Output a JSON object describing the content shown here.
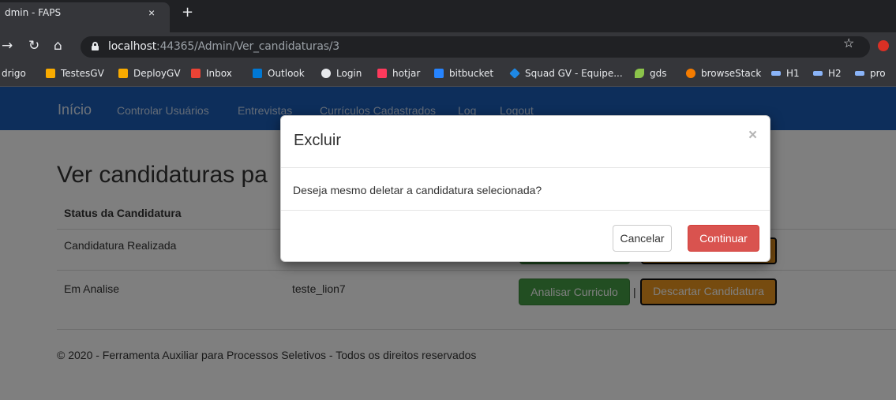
{
  "browser": {
    "tab_title": "dmin - FAPS",
    "tab_close": "×",
    "new_tab": "+",
    "url_host": "localhost",
    "url_rest": ":44365/Admin/Ver_candidaturas/3",
    "bookmarks": [
      {
        "label": "drigo",
        "color": "#000000"
      },
      {
        "label": "TestesGV",
        "color": "#f9ab00"
      },
      {
        "label": "DeployGV",
        "color": "#f9ab00"
      },
      {
        "label": "Inbox",
        "color": "#ea4335"
      },
      {
        "label": "Outlook",
        "color": "#0078d4"
      },
      {
        "label": "Login",
        "color": "#e8eaed"
      },
      {
        "label": "hotjar",
        "color": "#fd3a5c"
      },
      {
        "label": "bitbucket",
        "color": "#2684ff"
      },
      {
        "label": "Squad GV - Equipe...",
        "color": "#1e88e5"
      },
      {
        "label": "gds",
        "color": "#8bc34a"
      },
      {
        "label": "browseStack",
        "color": "#f57c00"
      },
      {
        "label": "H1",
        "color": "#8ab4f8"
      },
      {
        "label": "H2",
        "color": "#8ab4f8"
      },
      {
        "label": "pro",
        "color": "#8ab4f8"
      }
    ]
  },
  "nav": {
    "brand": "Início",
    "links": [
      "Controlar Usuários",
      "Entrevistas",
      "Currículos Cadastrados",
      "Log",
      "Logout"
    ]
  },
  "page": {
    "title": "Ver candidaturas pa",
    "column_status": "Status da Candidatura",
    "rows": [
      {
        "status": "Candidatura Realizada",
        "user": ""
      },
      {
        "status": "Em Analise",
        "user": "teste_lion7"
      }
    ],
    "btn_analyze": "Analisar Curriculo",
    "separator": "|",
    "btn_discard": "Descartar Candidatura",
    "footer": "© 2020 - Ferramenta Auxiliar para Processos Seletivos - Todos os direitos reservados"
  },
  "modal": {
    "title": "Excluir",
    "close": "×",
    "body": "Deseja mesmo deletar a candidatura selecionada?",
    "cancel": "Cancelar",
    "confirm": "Continuar"
  },
  "colors": {
    "nav_bg": "#1a5db6",
    "success": "#449d44",
    "warning": "#ec971f",
    "danger": "#d9534f"
  }
}
